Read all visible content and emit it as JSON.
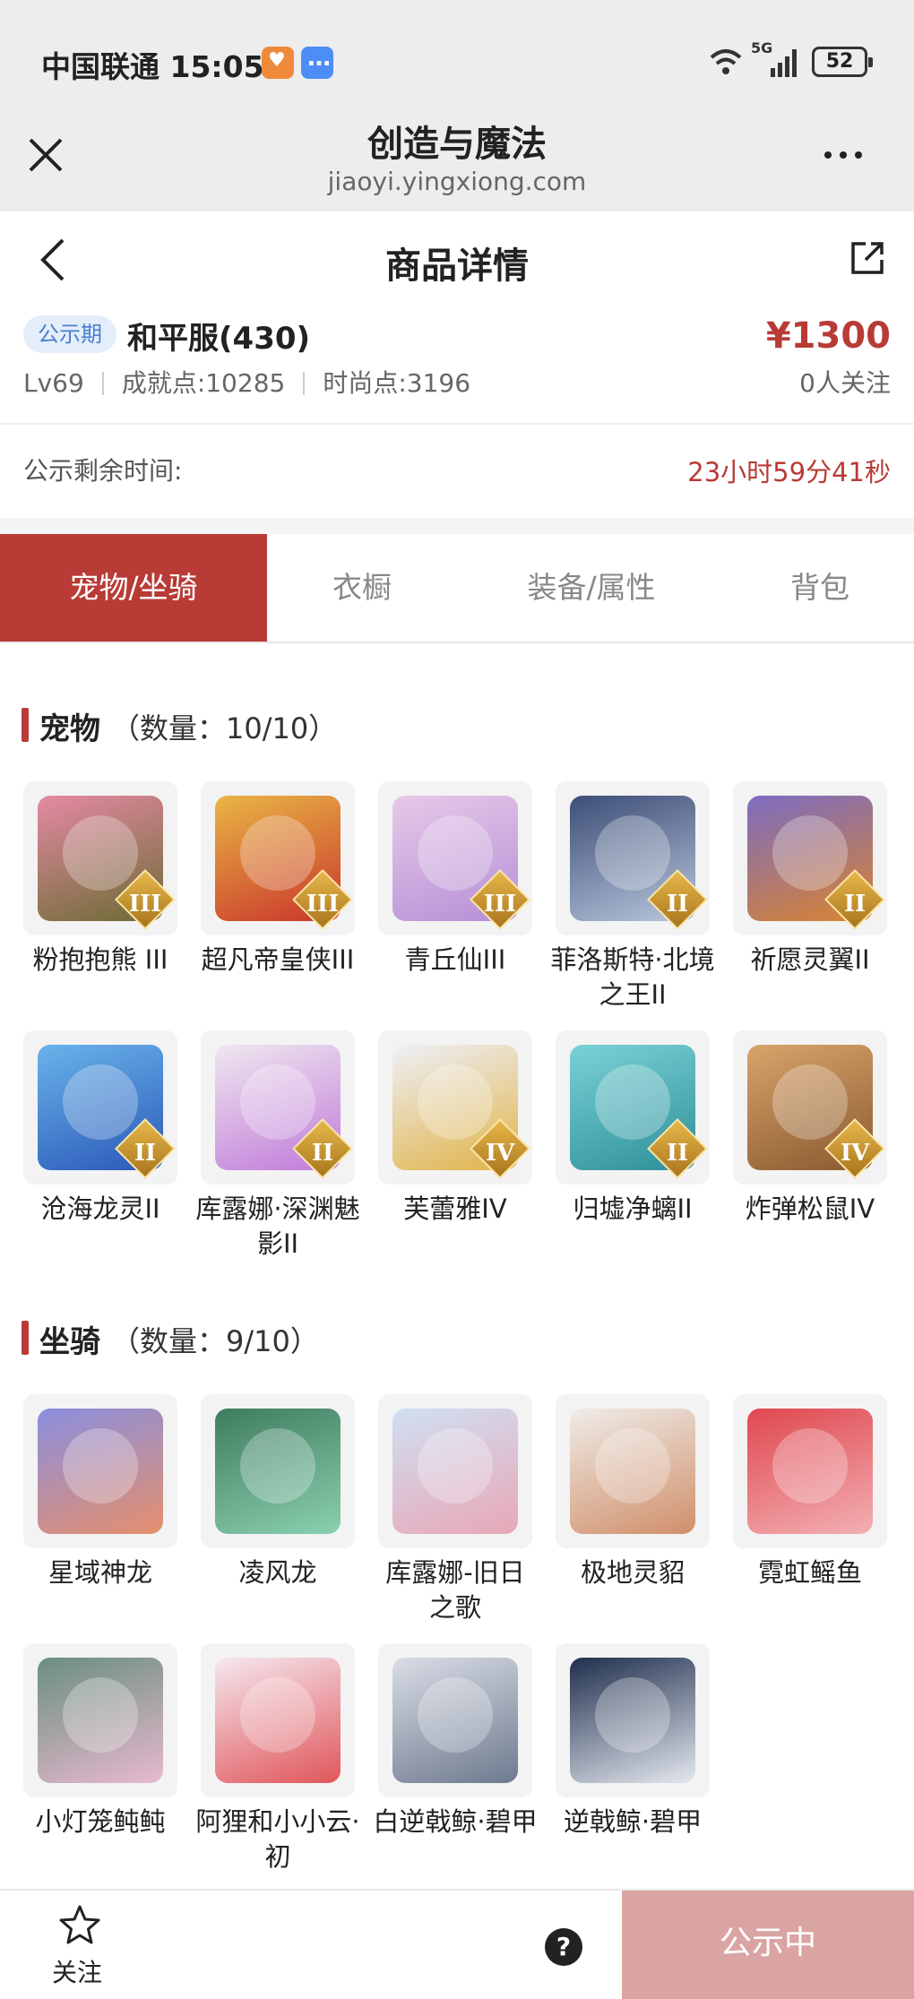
{
  "status_bar": {
    "carrier_time": "中国联通 15:05",
    "network": "5G",
    "battery": "52"
  },
  "browser": {
    "title": "创造与魔法",
    "domain": "jiaoyi.yingxiong.com"
  },
  "page": {
    "title": "商品详情"
  },
  "summary": {
    "badge": "公示期",
    "server": "和平服(430)",
    "price": "¥1300",
    "level": "Lv69",
    "achievement": "成就点:10285",
    "fashion": "时尚点:3196",
    "followers": "0人关注"
  },
  "remain": {
    "label": "公示剩余时间:",
    "value": "23小时59分41秒"
  },
  "tabs": [
    {
      "label": "宠物/坐骑",
      "active": true
    },
    {
      "label": "衣橱",
      "active": false
    },
    {
      "label": "装备/属性",
      "active": false
    },
    {
      "label": "背包",
      "active": false
    }
  ],
  "pets": {
    "title": "宠物",
    "count": "（数量：10/10）",
    "items": [
      {
        "name": "粉抱抱熊 III",
        "grade": "III",
        "color": "#e58aa4",
        "accent": "#6b6b33"
      },
      {
        "name": "超凡帝皇侠III",
        "grade": "III",
        "color": "#e9b545",
        "accent": "#c9362b"
      },
      {
        "name": "青丘仙III",
        "grade": "III",
        "color": "#e7c9e8",
        "accent": "#b58fd6"
      },
      {
        "name": "菲洛斯特·北境之王II",
        "grade": "II",
        "color": "#3d4e77",
        "accent": "#b8c6dc"
      },
      {
        "name": "祈愿灵翼II",
        "grade": "II",
        "color": "#7c6cc2",
        "accent": "#d9842f"
      },
      {
        "name": "沧海龙灵II",
        "grade": "II",
        "color": "#6ab3ea",
        "accent": "#2a58b8"
      },
      {
        "name": "库露娜·深渊魅影II",
        "grade": "II",
        "color": "#efe7ef",
        "accent": "#c07ad9"
      },
      {
        "name": "芙蕾雅IV",
        "grade": "IV",
        "color": "#eef0f7",
        "accent": "#e0b347"
      },
      {
        "name": "归墟净螭II",
        "grade": "II",
        "color": "#7ad2d6",
        "accent": "#2e8f9a"
      },
      {
        "name": "炸弹松鼠IV",
        "grade": "IV",
        "color": "#d8a46b",
        "accent": "#8a5a2f"
      }
    ]
  },
  "mounts": {
    "title": "坐骑",
    "count": "（数量：9/10）",
    "items": [
      {
        "name": "星域神龙",
        "color": "#8a8fe0",
        "accent": "#e58f6c"
      },
      {
        "name": "凌风龙",
        "color": "#3f7c5f",
        "accent": "#8ad0b0"
      },
      {
        "name": "库露娜-旧日之歌",
        "color": "#cfe0f2",
        "accent": "#e8a7b7"
      },
      {
        "name": "极地灵貂",
        "color": "#efece8",
        "accent": "#d08f6a"
      },
      {
        "name": "霓虹鳐鱼",
        "color": "#e0474f",
        "accent": "#f2b0b3"
      },
      {
        "name": "小灯笼鲀鲀",
        "color": "#6a8f7f",
        "accent": "#e7b9cf"
      },
      {
        "name": "阿狸和小小云·初",
        "color": "#f5e8ef",
        "accent": "#e0565a"
      },
      {
        "name": "白逆戟鲸·碧甲",
        "color": "#d9dde6",
        "accent": "#6e7a8f"
      },
      {
        "name": "逆戟鲸·碧甲",
        "color": "#1f2e4d",
        "accent": "#e4e8ef"
      }
    ]
  },
  "bottom_bar": {
    "follow": "关注",
    "help": "?",
    "status": "公示中"
  }
}
